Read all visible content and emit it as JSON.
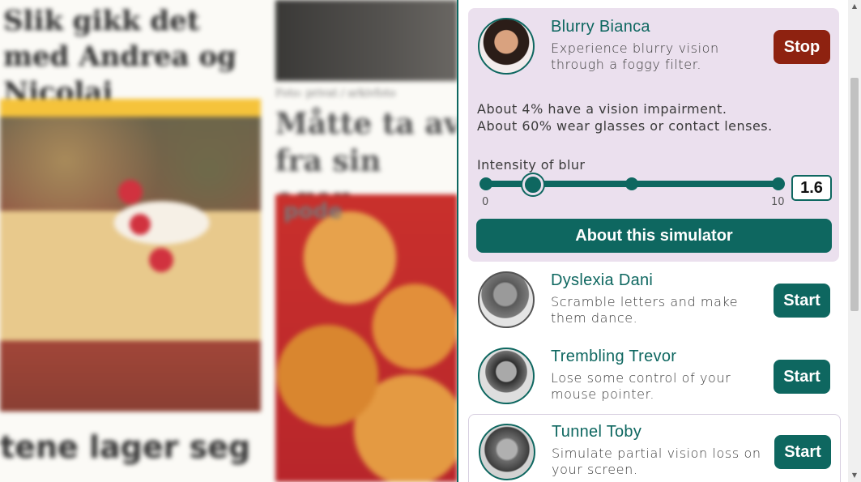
{
  "background": {
    "headline_left": "Slik gikk det med Andrea og Nicolai",
    "caption_right": "Foto: privat / arkivfoto",
    "headline_right": "Måtte ta av fra sin egen",
    "headline_bottom": "tene lager seg",
    "photo_tag": "pode"
  },
  "simulators": [
    {
      "name": "Blurry Bianca",
      "description": "Experience blurry vision through a foggy filter.",
      "button": "Stop",
      "stats": [
        "About 4% have a vision impairment.",
        "About 60% wear glasses or contact lenses."
      ],
      "slider": {
        "label": "Intensity of blur",
        "min": "0",
        "max": "10",
        "value": "1.6",
        "value_num": 1.6
      },
      "about_button": "About this simulator"
    },
    {
      "name": "Dyslexia Dani",
      "description": "Scramble letters and make them dance.",
      "button": "Start"
    },
    {
      "name": "Trembling Trevor",
      "description": "Lose some control of your mouse pointer.",
      "button": "Start"
    },
    {
      "name": "Tunnel Toby",
      "description": "Simulate partial vision loss on your screen.",
      "button": "Start"
    }
  ],
  "colors": {
    "accent": "#0e6760",
    "stop": "#8e2210",
    "active_card": "#ebe0ee"
  }
}
